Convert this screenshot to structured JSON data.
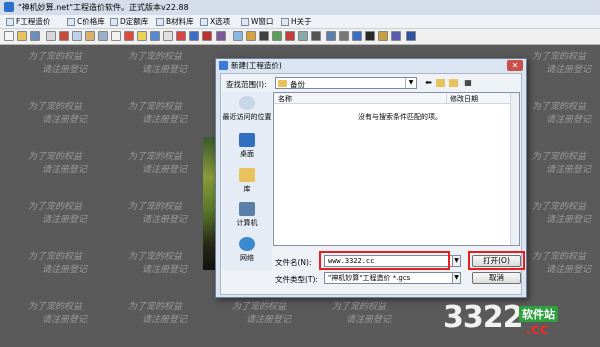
{
  "app": {
    "title": "\"神机妙算.net\"工程造价软件。正式版本v22.88"
  },
  "menu": [
    "F工程造价",
    "C价格库",
    "D定额库",
    "B材料库",
    "X选项",
    "W窗口",
    "H关于"
  ],
  "watermark": {
    "line1": "为了宠的权益",
    "line2": "请注册登记"
  },
  "site_logo": {
    "number": "3322",
    "chinese": "软件站",
    "domain": ".cc"
  },
  "dialog": {
    "title": "新建(工程造价)",
    "close": "✕",
    "lookin_label": "查找范围(I):",
    "lookin_value": "备份",
    "places": [
      "最近访问的位置",
      "桌面",
      "库",
      "计算机",
      "网络"
    ],
    "columns": [
      "名称",
      "修改日期"
    ],
    "empty_message": "没有与搜索条件匹配的项。",
    "filename_label": "文件名(N):",
    "filename_value": "www.3322.cc",
    "filetype_label": "文件类型(T):",
    "filetype_value": "\"神机妙算\"工程造价 *.gcs",
    "open_label": "打开(O)",
    "cancel_label": "取消"
  },
  "colors": {
    "highlight": "#e61e1e",
    "workspace": "#5a5a5a"
  }
}
